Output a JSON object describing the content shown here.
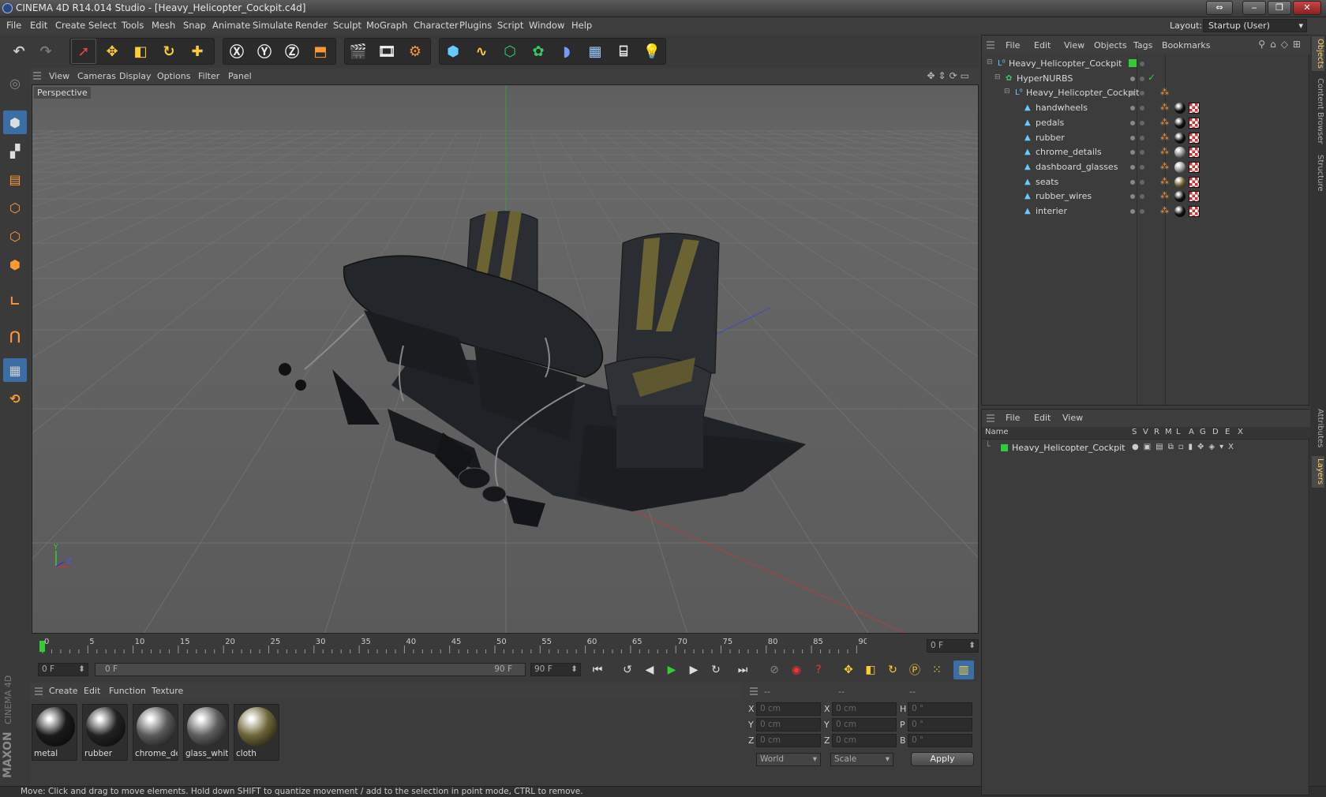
{
  "app": {
    "title": "CINEMA 4D R14.014 Studio - [Heavy_Helicopter_Cockpit.c4d]",
    "layout_label": "Layout:",
    "layout_value": "Startup (User)"
  },
  "menu": [
    "File",
    "Edit",
    "Create",
    "Select",
    "Tools",
    "Mesh",
    "Snap",
    "Animate",
    "Simulate",
    "Render",
    "Sculpt",
    "MoGraph",
    "Character",
    "Plugins",
    "Script",
    "Window",
    "Help"
  ],
  "viewport": {
    "menu": [
      "View",
      "Cameras",
      "Display",
      "Options",
      "Filter",
      "Panel"
    ],
    "label": "Perspective",
    "axis_labels": {
      "y": "Y",
      "z": "Z"
    }
  },
  "timeline": {
    "ticks": [
      "0",
      "5",
      "10",
      "15",
      "20",
      "25",
      "30",
      "35",
      "40",
      "45",
      "50",
      "55",
      "60",
      "65",
      "70",
      "75",
      "80",
      "85",
      "90"
    ],
    "end_frame": "0 F",
    "start_field": "0 F",
    "range_start": "0 F",
    "range_end": "90 F",
    "max_field": "90 F"
  },
  "materials": {
    "menu": [
      "Create",
      "Edit",
      "Function",
      "Texture"
    ],
    "items": [
      {
        "name": "metal",
        "color": "#1a1a1a"
      },
      {
        "name": "rubber",
        "color": "#222222"
      },
      {
        "name": "chrome_de",
        "color": "#5a5a5a"
      },
      {
        "name": "glass_whit",
        "color": "#5e5e5e"
      },
      {
        "name": "cloth",
        "color": "#6e6638"
      }
    ]
  },
  "coords": {
    "headers": [
      "--",
      "--",
      "--"
    ],
    "rows": [
      {
        "a": "X",
        "av": "0 cm",
        "b": "X",
        "bv": "0 cm",
        "c": "H",
        "cv": "0 °"
      },
      {
        "a": "Y",
        "av": "0 cm",
        "b": "Y",
        "bv": "0 cm",
        "c": "P",
        "cv": "0 °"
      },
      {
        "a": "Z",
        "av": "0 cm",
        "b": "Z",
        "bv": "0 cm",
        "c": "B",
        "cv": "0 °"
      }
    ],
    "mode": "World",
    "size_mode": "Scale",
    "apply": "Apply"
  },
  "status": "Move: Click and drag to move elements. Hold down SHIFT to quantize movement / add to the selection in point mode, CTRL to remove.",
  "maxon": {
    "brand": "MAXON",
    "product": "CINEMA 4D"
  },
  "objects": {
    "menu": [
      "File",
      "Edit",
      "View",
      "Objects",
      "Tags",
      "Bookmarks"
    ],
    "tree": [
      {
        "name": "Heavy_Helicopter_Cockpit",
        "icon": "null-icon"
      },
      {
        "name": "HyperNURBS",
        "icon": "hypernurbs-icon"
      },
      {
        "name": "Heavy_Helicopter_Cockpit",
        "icon": "null-icon"
      },
      {
        "name": "handwheels",
        "icon": "polygon-icon",
        "mat": "#111111"
      },
      {
        "name": "pedals",
        "icon": "polygon-icon",
        "mat": "#111111"
      },
      {
        "name": "rubber",
        "icon": "polygon-icon",
        "mat": "#111111"
      },
      {
        "name": "chrome_details",
        "icon": "polygon-icon",
        "mat": "#8a8a8a"
      },
      {
        "name": "dashboard_glasses",
        "icon": "polygon-icon",
        "mat": "#9a9a9a"
      },
      {
        "name": "seats",
        "icon": "polygon-icon",
        "mat": "#6e6638"
      },
      {
        "name": "rubber_wires",
        "icon": "polygon-icon",
        "mat": "#111111"
      },
      {
        "name": "interier",
        "icon": "polygon-icon",
        "mat": "#111111"
      }
    ]
  },
  "layers": {
    "menu": [
      "File",
      "Edit",
      "View"
    ],
    "columns": [
      "Name",
      "S",
      "V",
      "R",
      "M",
      "L",
      "A",
      "G",
      "D",
      "E",
      "X"
    ],
    "rows": [
      {
        "name": "Heavy_Helicopter_Cockpit",
        "color": "#2ecc40"
      }
    ]
  },
  "side_tabs": [
    "Objects",
    "Content Browser",
    "Structure",
    "Attributes",
    "Layers"
  ]
}
